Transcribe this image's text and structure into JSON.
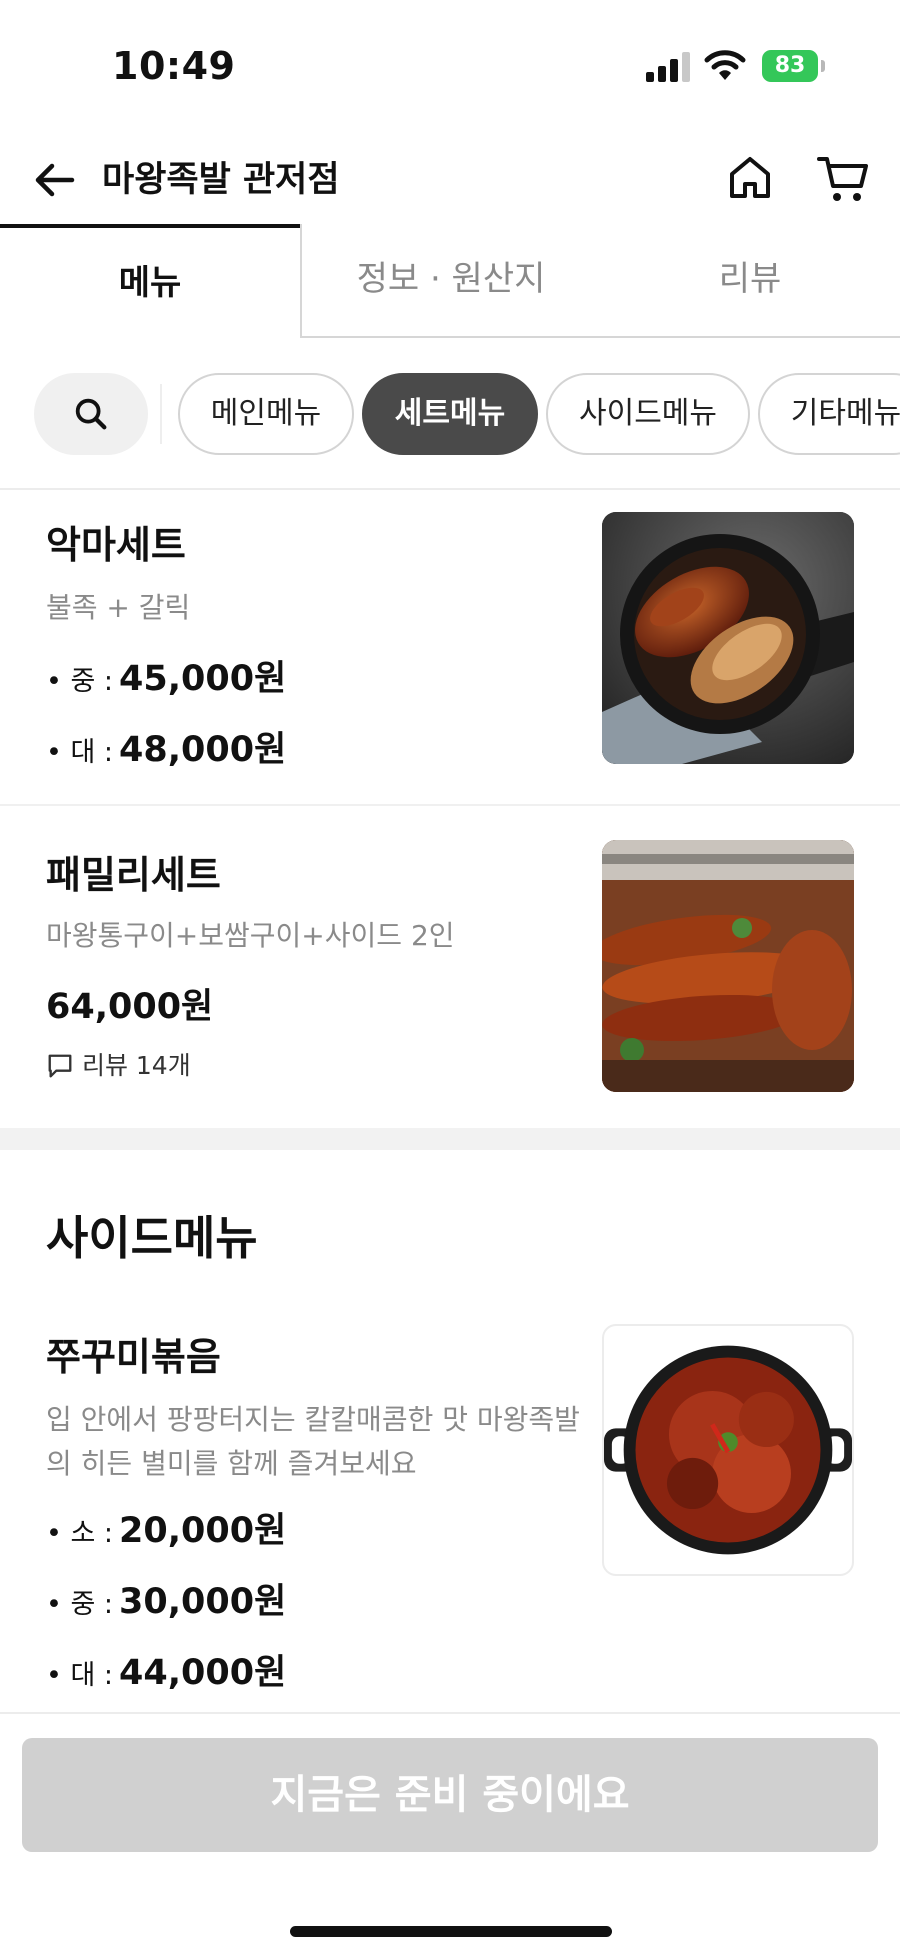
{
  "status": {
    "time": "10:49",
    "battery": "83"
  },
  "header": {
    "title": "마왕족발 관저점"
  },
  "tabs": [
    {
      "label": "메뉴"
    },
    {
      "label": "정보 · 원산지"
    },
    {
      "label": "리뷰"
    }
  ],
  "chips": [
    {
      "label": "메인메뉴"
    },
    {
      "label": "세트메뉴"
    },
    {
      "label": "사이드메뉴"
    },
    {
      "label": "기타메뉴"
    }
  ],
  "items": {
    "akma": {
      "name": "악마세트",
      "desc": "불족 + 갈릭",
      "prices": [
        {
          "label": "• 중 :",
          "value": "45,000원"
        },
        {
          "label": "• 대 :",
          "value": "48,000원"
        }
      ]
    },
    "family": {
      "name": "패밀리세트",
      "desc": "마왕통구이+보쌈구이+사이드 2인",
      "price": "64,000원",
      "review": "리뷰 14개"
    },
    "jjukku": {
      "name": "쭈꾸미볶음",
      "desc": "입 안에서 팡팡터지는 칼칼매콤한 맛 마왕족발의 히든 별미를 함께 즐겨보세요",
      "prices": [
        {
          "label": "• 소 :",
          "value": "20,000원"
        },
        {
          "label": "• 중 :",
          "value": "30,000원"
        },
        {
          "label": "• 대 :",
          "value": "44,000원"
        }
      ]
    }
  },
  "section": {
    "side_title": "사이드메뉴"
  },
  "order_button": {
    "label": "지금은 준비 중이에요"
  },
  "colors": {
    "active_chip": "#4a4a4a",
    "battery": "#34c759",
    "disabled_button": "#d0d0d0"
  }
}
